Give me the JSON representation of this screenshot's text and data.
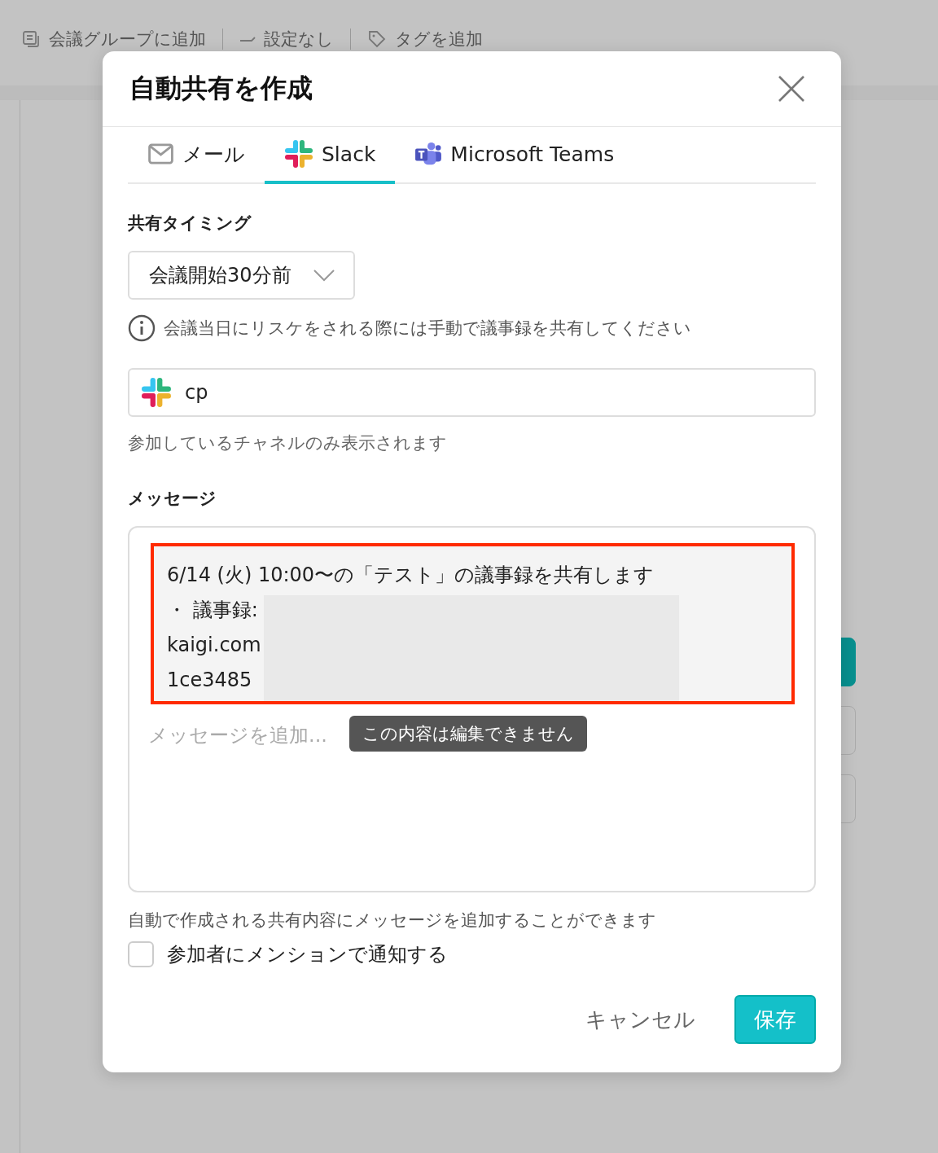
{
  "background": {
    "toolbar": [
      {
        "kind": "group",
        "label": "会議グループに追加"
      },
      {
        "kind": "tag-off",
        "label": "設定なし"
      },
      {
        "kind": "tag",
        "label": "タグを追加"
      }
    ]
  },
  "dialog": {
    "title": "自動共有を作成",
    "tabs": [
      {
        "kind": "mail",
        "label": "メール",
        "selected": false
      },
      {
        "kind": "slack",
        "label": "Slack",
        "selected": true
      },
      {
        "kind": "teams",
        "label": "Microsoft Teams",
        "selected": false
      }
    ],
    "timing": {
      "label": "共有タイミング",
      "value": "会議開始30分前",
      "note": "会議当日にリスケをされる際には手動で議事録を共有してください"
    },
    "channel": {
      "value": "cp",
      "hint": "参加しているチャネルのみ表示されます"
    },
    "message": {
      "label": "メッセージ",
      "fixed_lines": [
        "6/14 (火) 10:00〜の「テスト」の議事録を共有します",
        "・ 議事録:",
        "kaigi.com",
        "1ce3485"
      ],
      "placeholder": "メッセージを追加...",
      "tooltip": "この内容は編集できません",
      "hint": "自動で作成される共有内容にメッセージを追加することができます"
    },
    "mention": {
      "label": "参加者にメンションで通知する",
      "checked": false
    },
    "buttons": [
      {
        "kind": "secondary",
        "label": "キャンセル"
      },
      {
        "kind": "primary",
        "label": "保存"
      }
    ]
  }
}
